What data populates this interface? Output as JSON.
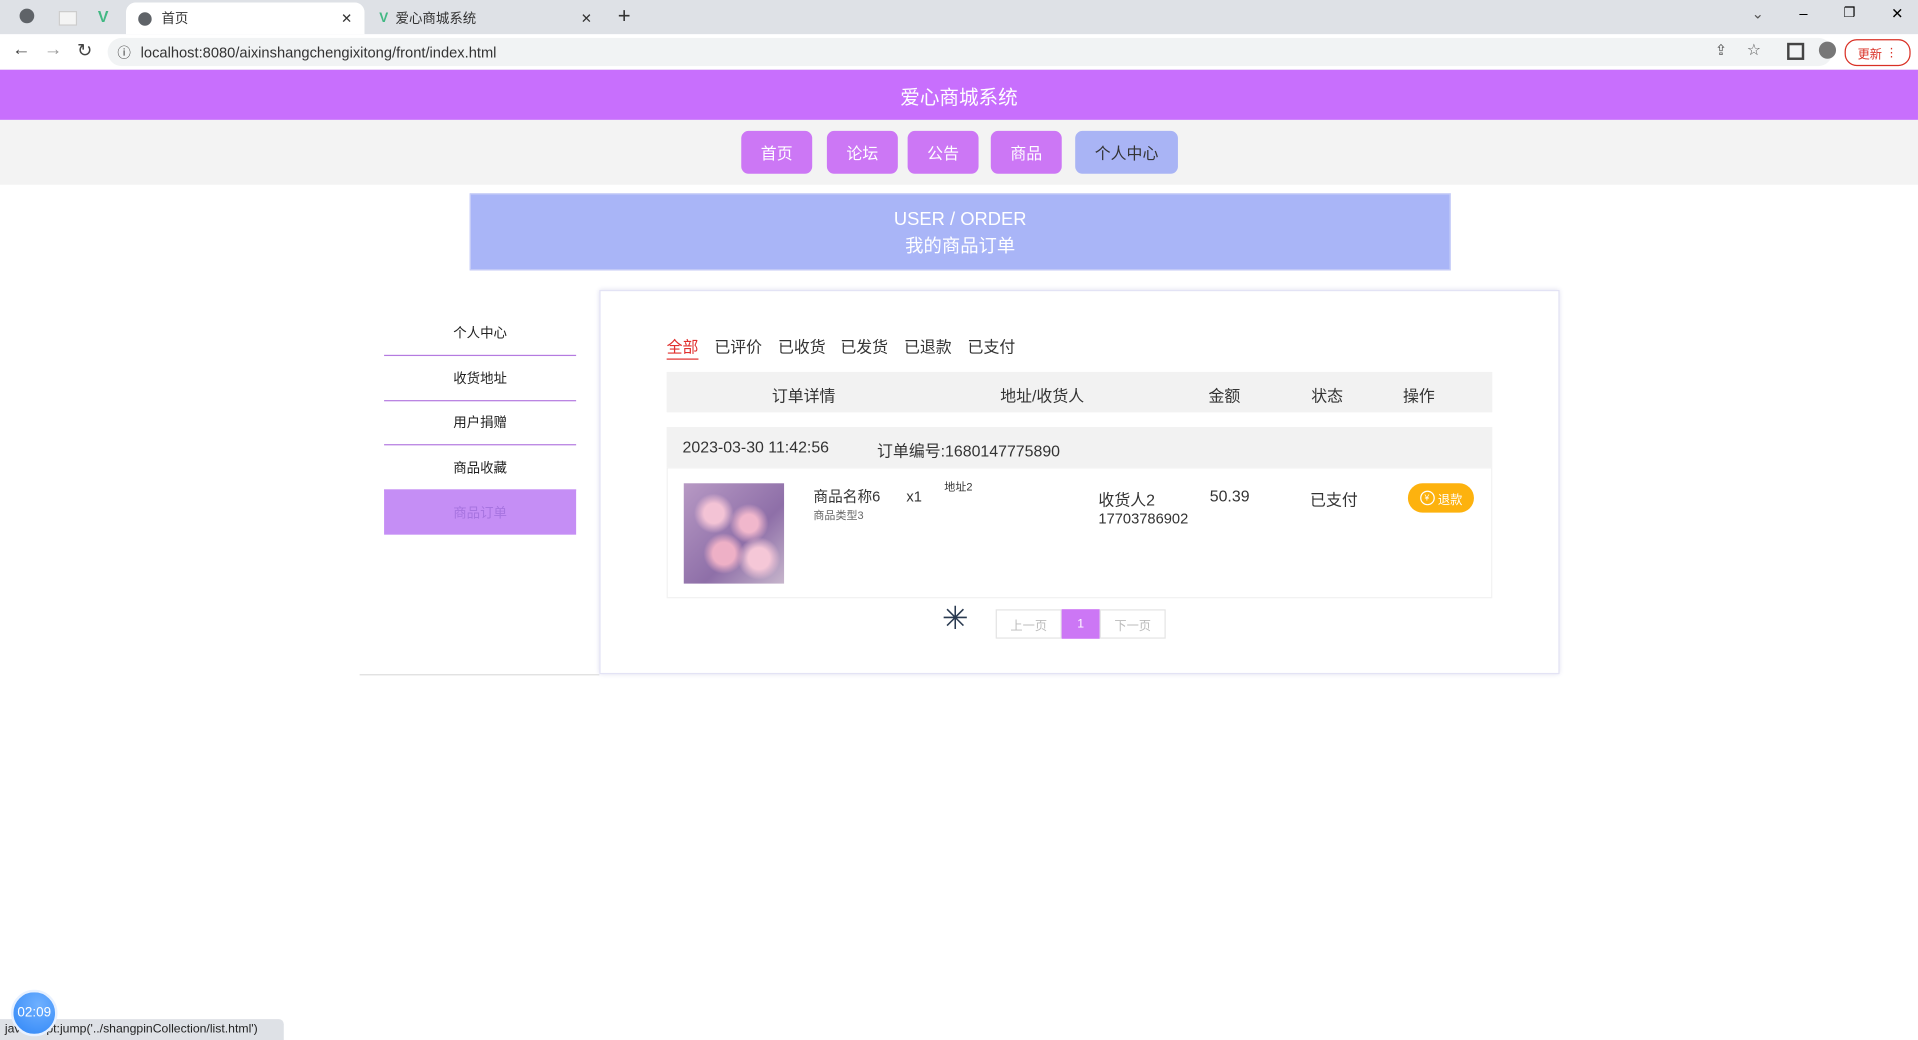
{
  "browser": {
    "tabs": [
      {
        "label": "首页"
      },
      {
        "label": "爱心商城系统"
      }
    ],
    "url": "localhost:8080/aixinshangchengixitong/front/index.html",
    "update_label": "更新"
  },
  "header": {
    "title": "爱心商城系统"
  },
  "nav": [
    {
      "label": "首页"
    },
    {
      "label": "论坛"
    },
    {
      "label": "公告"
    },
    {
      "label": "商品"
    },
    {
      "label": "个人中心"
    }
  ],
  "banner": {
    "en": "USER / ORDER",
    "cn": "我的商品订单"
  },
  "sidebar": [
    {
      "label": "个人中心"
    },
    {
      "label": "收货地址"
    },
    {
      "label": "用户捐赠"
    },
    {
      "label": "商品收藏"
    },
    {
      "label": "商品订单"
    }
  ],
  "order_tabs": [
    {
      "label": "全部"
    },
    {
      "label": "已评价"
    },
    {
      "label": "已收货"
    },
    {
      "label": "已发货"
    },
    {
      "label": "已退款"
    },
    {
      "label": "已支付"
    }
  ],
  "table_headers": [
    "订单详情",
    "地址/收货人",
    "金额",
    "状态",
    "操作"
  ],
  "order": {
    "time": "2023-03-30 11:42:56",
    "number": "订单编号:1680147775890",
    "product_name": "商品名称6",
    "product_type": "商品类型3",
    "qty": "x1",
    "address": "地址2",
    "receiver": "收货人2",
    "phone": "17703786902",
    "amount": "50.39",
    "status": "已支付",
    "action": "退款"
  },
  "pagination": {
    "prev": "上一页",
    "current": "1",
    "next": "下一页"
  },
  "status_bar": "javascript:jump('../shangpinCollection/list.html')",
  "timer": "02:09"
}
